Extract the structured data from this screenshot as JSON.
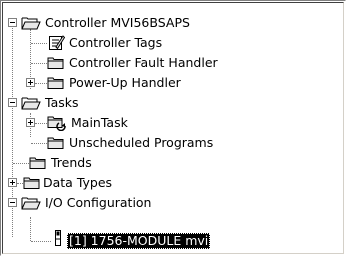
{
  "tree": {
    "controller_label": "Controller MVI56BSAPS",
    "controller_tags_label": "Controller Tags",
    "controller_fault_handler_label": "Controller Fault Handler",
    "power_up_handler_label": "Power-Up Handler",
    "tasks_label": "Tasks",
    "main_task_label": "MainTask",
    "unscheduled_programs_label": "Unscheduled Programs",
    "trends_label": "Trends",
    "data_types_label": "Data Types",
    "io_configuration_label": "I/O Configuration",
    "module_label": "[1] 1756-MODULE mvi",
    "selected_item": "[1] 1756-MODULE mvi"
  },
  "colors": {
    "folder_fill": "#e8e8e8",
    "folder_stroke": "#000000",
    "selection_bg": "#000000",
    "selection_text": "#ffffff",
    "connector": "#808080"
  },
  "icons": {
    "controller": "open-folder-icon",
    "controller_tags": "tags-notebook-icon",
    "controller_fault_handler": "folder-icon",
    "power_up_handler": "folder-icon",
    "tasks": "open-folder-icon",
    "main_task": "task-cycle-folder-icon",
    "unscheduled_programs": "folder-icon",
    "trends": "folder-icon",
    "data_types": "folder-icon",
    "io_configuration": "open-folder-icon",
    "module": "io-module-icon"
  }
}
